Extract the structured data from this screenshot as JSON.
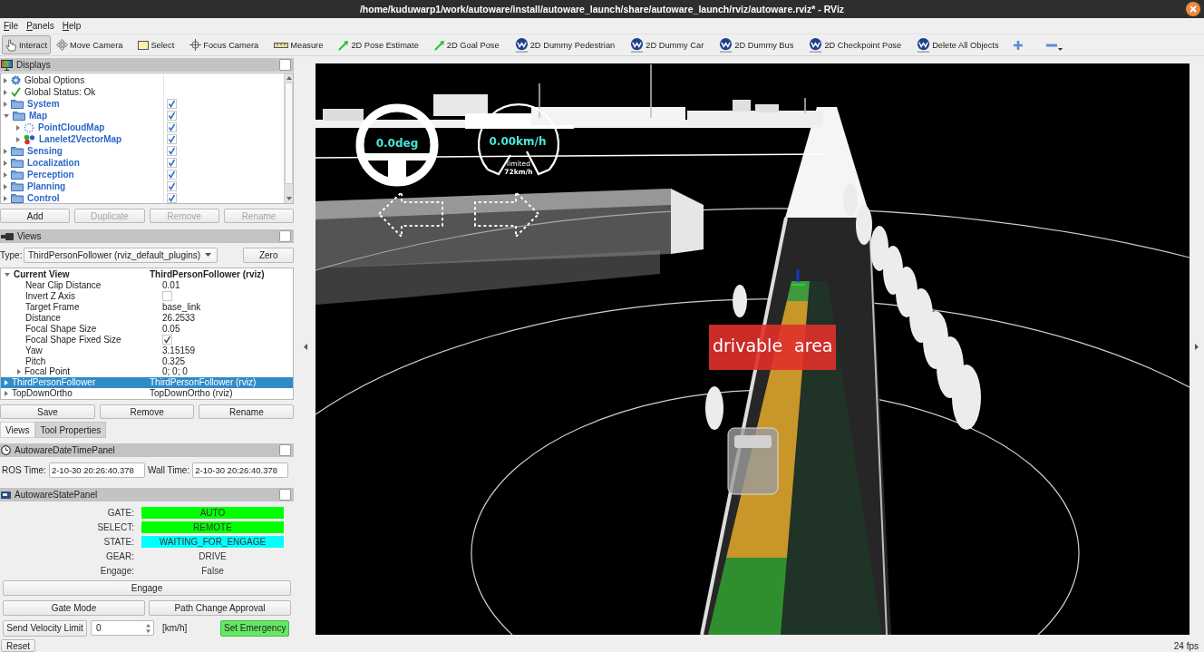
{
  "window": {
    "title": "/home/kuduwarp1/work/autoware/install/autoware_launch/share/autoware_launch/rviz/autoware.rviz* - RViz"
  },
  "menu": [
    "File",
    "Panels",
    "Help"
  ],
  "toolbar": [
    {
      "label": "Interact",
      "kind": "hand",
      "selected": true
    },
    {
      "label": "Move Camera",
      "kind": "move",
      "selected": false
    },
    {
      "label": "Select",
      "kind": "select",
      "selected": false
    },
    {
      "label": "Focus Camera",
      "kind": "focus",
      "selected": false
    },
    {
      "label": "Measure",
      "kind": "measure",
      "selected": false
    },
    {
      "label": "2D Pose Estimate",
      "kind": "pose",
      "selected": false
    },
    {
      "label": "2D Goal Pose",
      "kind": "pose",
      "selected": false
    },
    {
      "label": "2D Dummy Pedestrian",
      "kind": "logo",
      "selected": false
    },
    {
      "label": "2D Dummy Car",
      "kind": "logo",
      "selected": false
    },
    {
      "label": "2D Dummy Bus",
      "kind": "logo",
      "selected": false
    },
    {
      "label": "2D Checkpoint Pose",
      "kind": "logo",
      "selected": false
    },
    {
      "label": "Delete All Objects",
      "kind": "logo",
      "selected": false
    }
  ],
  "displays": {
    "title": "Displays",
    "global_options": "Global Options",
    "global_status": "Global Status: Ok",
    "items": [
      {
        "name": "System",
        "kind": "folder",
        "checked": true,
        "expanded": false
      },
      {
        "name": "Map",
        "kind": "folder",
        "checked": true,
        "expanded": true,
        "children": [
          {
            "name": "PointCloudMap",
            "kind": "pointcloud",
            "checked": true,
            "expanded": false
          },
          {
            "name": "Lanelet2VectorMap",
            "kind": "vectormap",
            "checked": true,
            "expanded": false
          }
        ]
      },
      {
        "name": "Sensing",
        "kind": "folder",
        "checked": true,
        "expanded": false
      },
      {
        "name": "Localization",
        "kind": "folder",
        "checked": true,
        "expanded": false
      },
      {
        "name": "Perception",
        "kind": "folder",
        "checked": true,
        "expanded": false
      },
      {
        "name": "Planning",
        "kind": "folder",
        "checked": true,
        "expanded": false
      },
      {
        "name": "Control",
        "kind": "folder",
        "checked": true,
        "expanded": false
      }
    ],
    "buttons": [
      {
        "label": "Add",
        "disabled": false
      },
      {
        "label": "Duplicate",
        "disabled": true
      },
      {
        "label": "Remove",
        "disabled": true
      },
      {
        "label": "Rename",
        "disabled": true
      }
    ]
  },
  "views": {
    "title": "Views",
    "type_label": "Type:",
    "type_value": "ThirdPersonFollower (rviz_default_plugins)",
    "zero_button": "Zero",
    "tree": [
      {
        "name": "Current View",
        "value": "ThirdPersonFollower (rviz)",
        "kind": "current",
        "expanded": true,
        "selected": false,
        "children": [
          {
            "name": "Near Clip Distance",
            "kind": "text",
            "value": "0.01"
          },
          {
            "name": "Invert Z Axis",
            "kind": "checkbox",
            "checked": false
          },
          {
            "name": "Target Frame",
            "kind": "text",
            "value": "base_link"
          },
          {
            "name": "Distance",
            "kind": "text",
            "value": "26.2533"
          },
          {
            "name": "Focal Shape Size",
            "kind": "text",
            "value": "0.05"
          },
          {
            "name": "Focal Shape Fixed Size",
            "kind": "checkbox",
            "checked": true
          },
          {
            "name": "Yaw",
            "kind": "text",
            "value": "3.15159"
          },
          {
            "name": "Pitch",
            "kind": "text",
            "value": "0.325"
          },
          {
            "name": "Focal Point",
            "kind": "group",
            "value": "0; 0; 0",
            "expanded": false
          }
        ]
      },
      {
        "name": "ThirdPersonFollower",
        "value": "ThirdPersonFollower (rviz)",
        "kind": "saved",
        "expanded": false,
        "selected": true
      },
      {
        "name": "TopDownOrtho",
        "value": "TopDownOrtho (rviz)",
        "kind": "saved",
        "expanded": false,
        "selected": false
      }
    ],
    "buttons": [
      "Save",
      "Remove",
      "Rename"
    ]
  },
  "bottom_tabs": [
    {
      "label": "Views",
      "selected": true
    },
    {
      "label": "Tool Properties",
      "selected": false
    }
  ],
  "datetime_panel": {
    "title": "AutowareDateTimePanel",
    "ros_time_label": "ROS Time:",
    "ros_time": "2-10-30 20:26:40.378",
    "wall_time_label": "Wall Time:",
    "wall_time": "2-10-30 20:26:40.378"
  },
  "state_panel": {
    "title": "AutowareStatePanel",
    "rows": [
      {
        "label": "GATE:",
        "value": "AUTO",
        "color": "#00ff00"
      },
      {
        "label": "SELECT:",
        "value": "REMOTE",
        "color": "#00ff00"
      },
      {
        "label": "STATE:",
        "value": "WAITING_FOR_ENGAGE",
        "color": "#00ffff"
      },
      {
        "label": "GEAR:",
        "value": "DRIVE"
      },
      {
        "label": "Engage:",
        "value": "False"
      }
    ],
    "engage_button": "Engage",
    "gate_mode_button": "Gate Mode",
    "path_change_button": "Path Change Approval",
    "velocity_button": "Send Velocity Limit",
    "velocity_value": "0",
    "velocity_unit": "[km/h]",
    "emergency_button": "Set Emergency"
  },
  "viewport": {
    "steering_angle": "0.0deg",
    "speed": "0.00km/h",
    "limit_label": "limited",
    "limit_value": "72km/h",
    "drivable_area_label": "drivable area"
  },
  "status_bar": {
    "reset_button": "Reset",
    "fps": "24 fps"
  }
}
